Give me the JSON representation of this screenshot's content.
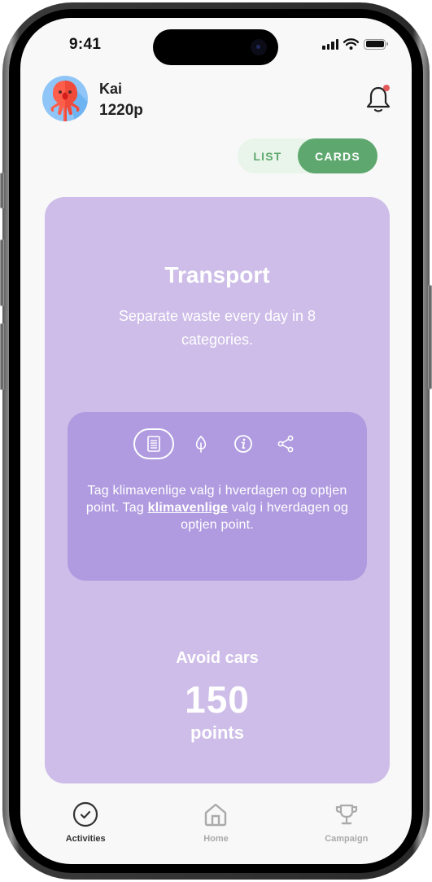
{
  "status_bar": {
    "time": "9:41"
  },
  "user": {
    "name": "Kai",
    "points": "1220p"
  },
  "notifications": {
    "has_unread": true,
    "dot_color": "#e05a5a"
  },
  "view_toggle": {
    "options": [
      {
        "label": "LIST",
        "selected": false
      },
      {
        "label": "CARDS",
        "selected": true
      }
    ],
    "accent": "#5ea86f"
  },
  "card": {
    "title": "Transport",
    "description": "Separate waste every day in 8 categories.",
    "background": "#cdbde8",
    "info_panel": {
      "tabs": [
        {
          "icon": "document-icon",
          "selected": true
        },
        {
          "icon": "leaf-icon",
          "selected": false
        },
        {
          "icon": "info-icon",
          "selected": false
        },
        {
          "icon": "share-icon",
          "selected": false
        }
      ],
      "text_before": "Tag klimavenlige valg i hverdagen og optjen point. Tag ",
      "text_link": "klimavenlige",
      "text_after": " valg i hverdagen og optjen point."
    },
    "activity": {
      "name": "Avoid cars",
      "points": "150",
      "unit": "points"
    }
  },
  "bottom_nav": {
    "items": [
      {
        "label": "Activities",
        "icon": "check-circle-icon",
        "active": true
      },
      {
        "label": "Home",
        "icon": "home-icon",
        "active": false
      },
      {
        "label": "Campaign",
        "icon": "trophy-icon",
        "active": false
      }
    ]
  }
}
